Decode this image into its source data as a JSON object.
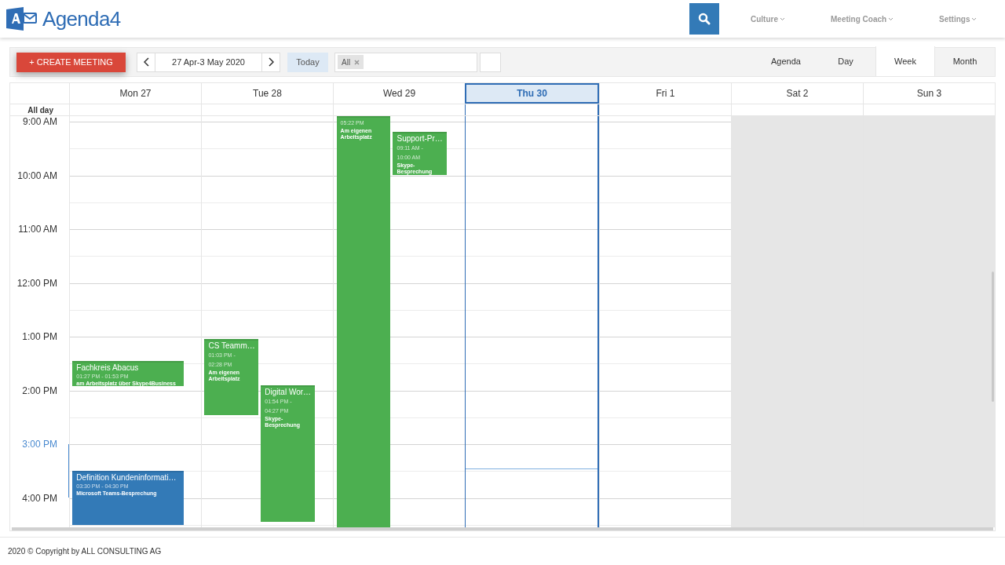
{
  "header": {
    "brand": "Agenda4",
    "menus": [
      {
        "label": "Culture"
      },
      {
        "label": "Meeting Coach"
      },
      {
        "label": "Settings"
      }
    ]
  },
  "toolbar": {
    "create_button": "+ CREATE MEETING",
    "date_range": "27 Apr-3 May 2020",
    "today_button": "Today",
    "filter_tags": [
      {
        "label": "All"
      }
    ],
    "views": [
      {
        "label": "Agenda",
        "selected": false
      },
      {
        "label": "Day",
        "selected": false
      },
      {
        "label": "Week",
        "selected": true
      },
      {
        "label": "Month",
        "selected": false
      }
    ]
  },
  "calendar": {
    "all_day_label": "All day",
    "hours": [
      "9:00 AM",
      "10:00 AM",
      "11:00 AM",
      "12:00 PM",
      "1:00 PM",
      "2:00 PM",
      "3:00 PM",
      "4:00 PM"
    ],
    "days": [
      {
        "label": "Mon 27",
        "selected": false,
        "weekend": false,
        "events": [
          {
            "title": "Fachkreis Abacus",
            "time": "01:27 PM - 01:53 PM",
            "location": "am Arbeitsplatz über Skype4Business",
            "color": "#4caf50"
          },
          {
            "title": "Definition Kundeninformati…",
            "time": "03:30 PM - 04:30 PM",
            "location": "Microsoft Teams-Besprechung",
            "color": "#337ab7"
          }
        ]
      },
      {
        "label": "Tue 28",
        "selected": false,
        "weekend": false,
        "events": [
          {
            "title": "CS Teamm…",
            "time": "01:03 PM - 02:28 PM",
            "location": "Am eigenen Arbeitsplatz",
            "color": "#4caf50"
          },
          {
            "title": "Digital Wor…",
            "time": "01:54 PM - 04:27 PM",
            "location": "Skype-Besprechung",
            "color": "#4caf50"
          }
        ]
      },
      {
        "label": "Wed 29",
        "selected": false,
        "weekend": false,
        "events": [
          {
            "time": "05:22 PM",
            "location": "Am eigenen Arbeitsplatz",
            "color": "#4caf50"
          },
          {
            "title": "Support-Pr…",
            "time": "09:11 AM - 10:00 AM",
            "location": "Skype-Besprechung",
            "color": "#4caf50"
          }
        ]
      },
      {
        "label": "Thu 30",
        "selected": true,
        "weekend": false
      },
      {
        "label": "Fri 1",
        "selected": false,
        "weekend": false
      },
      {
        "label": "Sat 2",
        "selected": false,
        "weekend": true
      },
      {
        "label": "Sun 3",
        "selected": false,
        "weekend": true
      }
    ]
  },
  "footer": "2020 © Copyright by ALL CONSULTING AG"
}
